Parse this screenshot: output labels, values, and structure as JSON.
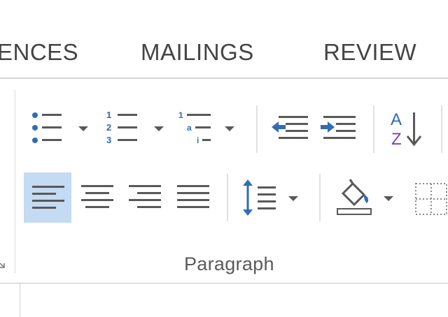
{
  "tabs": [
    {
      "id": "references",
      "label": "ENCES"
    },
    {
      "id": "mailings",
      "label": "MAILINGS"
    },
    {
      "id": "review",
      "label": "REVIEW"
    }
  ],
  "paragraph_group": {
    "label": "Paragraph"
  },
  "colors": {
    "icon_blue": "#2f6db5",
    "icon_gray": "#595959",
    "sort_purple": "#8a3da8",
    "selected_bg": "#c5daf3"
  }
}
